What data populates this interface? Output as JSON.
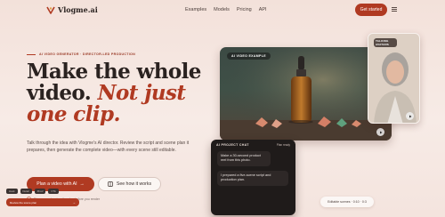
{
  "nav": {
    "brand": "Vlogme.ai",
    "links": [
      "Examples",
      "Models",
      "Pricing",
      "API"
    ],
    "cta": "Get started",
    "menu_icon": "hamburger-icon"
  },
  "hero": {
    "eyebrow": "AI VIDEO GENERATOR · DIRECTOR-LED PRODUCTION",
    "headline_1": "Make the whole video.",
    "headline_2": "Not just one clip.",
    "subcopy": "Talk through the idea with Vlogme's AI director. Review the script and scene plan it prepares, then generate the complete video—with every scene still editable.",
    "cta_primary": "Plan a video with AI",
    "cta_primary_icon": "arrow-right",
    "cta_secondary": "See how it works",
    "cta_secondary_icon": "grid-icon",
    "footnote": "Discuss and review the plan before you render"
  },
  "visual": {
    "video_label": "AI VIDEO EXAMPLE",
    "talking_label": "TALKING AVATARS",
    "chat": {
      "title": "AI PROJECT CHAT",
      "mode": "Plan ready",
      "user_message": "Make a 30-second product reel from this photo.",
      "ai_message": "I prepared a five-scene script and production plan.",
      "chips": [
        "Hook",
        "Detail",
        "Proof",
        "CTA"
      ],
      "action": "Review the scene plan"
    },
    "editable": "Editable scenes · 0:10 · 0:3"
  },
  "colors": {
    "accent": "#b03a22",
    "background": "#f3e1da",
    "dark_card": "#1f1b1a"
  }
}
